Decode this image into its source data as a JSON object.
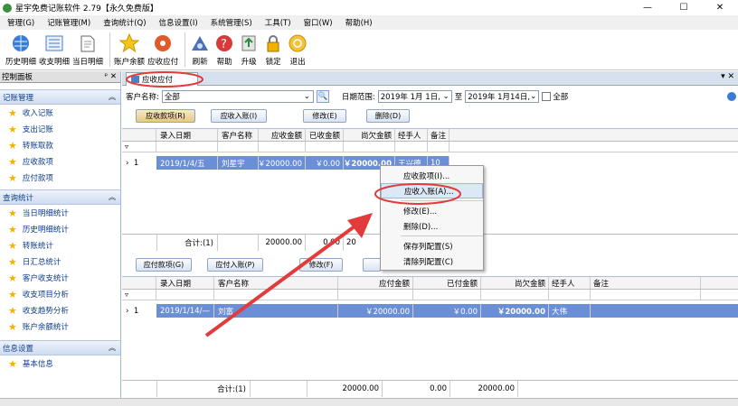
{
  "window": {
    "title": "星宇免费记账软件 2.79【永久免费版】",
    "btn_min": "—",
    "btn_max": "☐",
    "btn_close": "✕"
  },
  "menu": [
    "管理(G)",
    "记账管理(M)",
    "查询统计(Q)",
    "信息设置(I)",
    "系统管理(S)",
    "工具(T)",
    "窗口(W)",
    "帮助(H)"
  ],
  "toolbar": [
    {
      "label": "历史明细",
      "icon": "globe-icon"
    },
    {
      "label": "收支明细",
      "icon": "list-icon"
    },
    {
      "label": "当日明细",
      "icon": "document-icon"
    },
    {
      "label": "账户余额",
      "icon": "star-icon"
    },
    {
      "label": "应收应付",
      "icon": "cd-icon"
    },
    {
      "label": "刷新",
      "icon": "refresh-icon"
    },
    {
      "label": "帮助",
      "icon": "help-icon"
    },
    {
      "label": "升级",
      "icon": "upgrade-icon"
    },
    {
      "label": "锁定",
      "icon": "lock-icon"
    },
    {
      "label": "退出",
      "icon": "exit-icon"
    }
  ],
  "left_panel": {
    "title": "控制面板",
    "pin": "ᵖ ✕",
    "sections": [
      {
        "title": "记账管理",
        "items": [
          "收入记账",
          "支出记账",
          "转账取款",
          "应收款项",
          "应付款项"
        ]
      },
      {
        "title": "查询统计",
        "items": [
          "当日明细统计",
          "历史明细统计",
          "转账统计",
          "日汇总统计",
          "客户收支统计",
          "收支项目分析",
          "收支趋势分析",
          "账户余额统计"
        ]
      },
      {
        "title": "信息设置",
        "items": [
          "基本信息"
        ]
      }
    ]
  },
  "tab": {
    "label": "应收应付"
  },
  "filter": {
    "customer_label": "客户名称:",
    "customer_value": "全部",
    "date_label": "日期范围:",
    "date_from": "2019年 1月 1日,",
    "date_to_label": "至",
    "date_to": "2019年 1月14日,",
    "all_label": "全部"
  },
  "receivable": {
    "buttons": [
      "应收款项(R)",
      "应收入账(I)",
      "修改(E)",
      "删除(D)"
    ],
    "columns": [
      "录入日期",
      "客户名称",
      "应收金额",
      "已收金额",
      "尚欠金额",
      "经手人",
      "备注"
    ],
    "rows": [
      {
        "idx": "1",
        "date": "2019/1/4/五",
        "customer": "刘星宇",
        "due": "￥20000.00",
        "received": "￥0.00",
        "owed": "￥20000.00",
        "handler": "王兴德",
        "note": "10"
      }
    ],
    "footer": {
      "count": "合计:(1)",
      "due": "20000.00",
      "received": "0.00",
      "owed": "20"
    }
  },
  "payable": {
    "buttons": [
      "应付款项(G)",
      "应付入账(P)",
      "修改(F)"
    ],
    "columns": [
      "录入日期",
      "客户名称",
      "应付金额",
      "已付金额",
      "尚欠金额",
      "经手人",
      "备注"
    ],
    "rows": [
      {
        "idx": "1",
        "date": "2019/1/14/—",
        "customer": "刘富",
        "due": "￥20000.00",
        "paid": "￥0.00",
        "owed": "￥20000.00",
        "handler": "大伟",
        "note": ""
      }
    ],
    "footer": {
      "count": "合计:(1)",
      "due": "20000.00",
      "paid": "0.00",
      "owed": "20000.00"
    }
  },
  "context_menu": [
    "应收款项(I)...",
    "应收入账(A)...",
    "修改(E)...",
    "删除(D)...",
    "保存列配置(S)",
    "清除列配置(C)"
  ],
  "colors": {
    "accent": "#6b8fd6",
    "highlight_circle": "#e23b3b"
  }
}
